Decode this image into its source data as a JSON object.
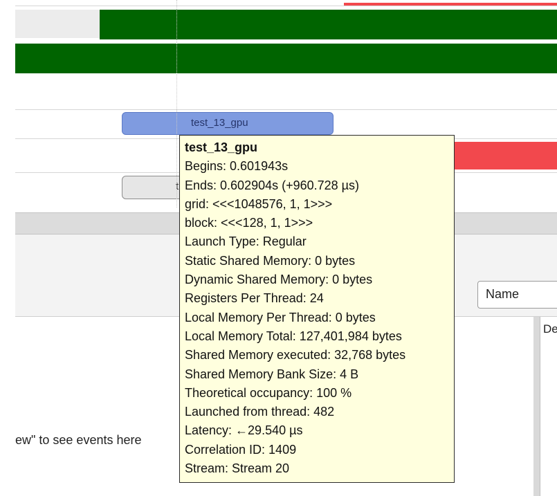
{
  "timeline": {
    "kernel_label": "test_13_gpu",
    "gray_pill_fragment": "t",
    "colors": {
      "green": "#006400",
      "red": "#f2484d",
      "kernel": "#7f9be0"
    }
  },
  "bottom": {
    "hint_text": "ew\" to see events here",
    "sort_select_value": "Name",
    "details_header": "De"
  },
  "tooltip": {
    "title": "test_13_gpu",
    "lines": [
      "Begins: 0.601943s",
      "Ends: 0.602904s (+960.728 µs)",
      "grid:  <<<1048576, 1, 1>>>",
      "block: <<<128, 1, 1>>>",
      "Launch Type: Regular",
      "Static Shared Memory: 0 bytes",
      "Dynamic Shared Memory: 0 bytes",
      "Registers Per Thread: 24",
      "Local Memory Per Thread: 0 bytes",
      "Local Memory Total: 127,401,984 bytes",
      "Shared Memory executed: 32,768 bytes",
      "Shared Memory Bank Size: 4 B",
      "Theoretical occupancy: 100 %",
      "Launched from thread: 482",
      "Latency: ←29.540 µs",
      "Correlation ID: 1409",
      "Stream: Stream 20"
    ]
  }
}
